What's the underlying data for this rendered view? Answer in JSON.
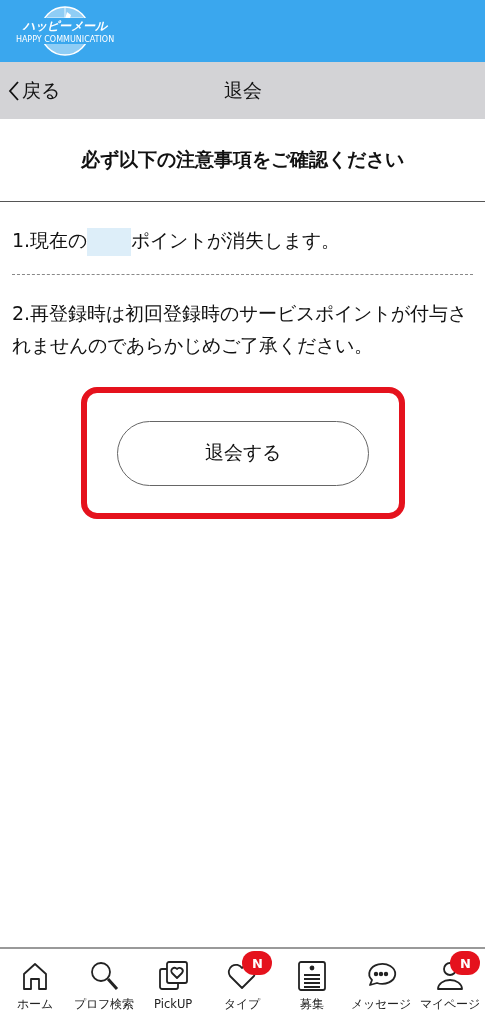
{
  "logo": {
    "name": "ハッピーメール",
    "tagline": "HAPPY COMMUNICATION"
  },
  "nav": {
    "back": "戻る",
    "title": "退会"
  },
  "heading": "必ず以下の注意事項をご確認ください",
  "notes": [
    {
      "before": "1.現在の",
      "masked": true,
      "after": "ポイントが消失します。"
    },
    {
      "before": "2.再登録時は初回登録時のサービスポイントが付与されませんのであらかじめご了承ください。",
      "masked": false
    }
  ],
  "withdraw_button": {
    "label": "退会する",
    "highlighted": true
  },
  "tabbar": [
    {
      "kind": "home",
      "label": "ホーム"
    },
    {
      "kind": "search",
      "label": "プロフ検索"
    },
    {
      "kind": "pickup",
      "label": "PickUP"
    },
    {
      "kind": "heart",
      "label": "タイプ",
      "badge": "N"
    },
    {
      "kind": "board",
      "label": "募集"
    },
    {
      "kind": "chat",
      "label": "メッセージ"
    },
    {
      "kind": "person",
      "label": "マイページ",
      "badge": "N"
    }
  ]
}
